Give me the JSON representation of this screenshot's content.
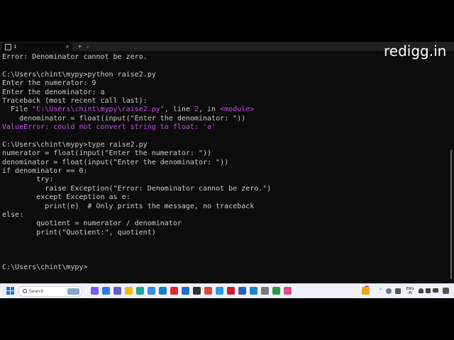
{
  "tabbar": {
    "tab_title": "1",
    "close_glyph": "×",
    "new_tab_glyph": "+",
    "dropdown_glyph": "⌄"
  },
  "watermark": "redigg.in",
  "terminal": {
    "lines": [
      [
        {
          "t": "Error: Denominator cannot be zero."
        }
      ],
      [
        {
          "t": ""
        }
      ],
      [
        {
          "t": "C:\\Users\\chint\\mypy>python raise2.py"
        }
      ],
      [
        {
          "t": "Enter the numerator: 9"
        }
      ],
      [
        {
          "t": "Enter the denominator: a"
        }
      ],
      [
        {
          "t": "Traceback (most recent call last):"
        }
      ],
      [
        {
          "t": "  File "
        },
        {
          "t": "\"C:\\Users\\chint\\mypy\\raise2.py\"",
          "c": "pink"
        },
        {
          "t": ", line "
        },
        {
          "t": "2",
          "c": "pink"
        },
        {
          "t": ", in "
        },
        {
          "t": "<module>",
          "c": "pink"
        }
      ],
      [
        {
          "t": "    denominator = float(input(\"Enter the denominator: \"))"
        }
      ],
      [
        {
          "t": "ValueError",
          "c": "pink"
        },
        {
          "t": ": could not convert string to float: 'a'",
          "c": "pink"
        }
      ],
      [
        {
          "t": ""
        }
      ],
      [
        {
          "t": "C:\\Users\\chint\\mypy>type raise2.py"
        }
      ],
      [
        {
          "t": "numerator = float(input(\"Enter the numerator: \"))"
        }
      ],
      [
        {
          "t": "denominator = float(input(\"Enter the denominator: \"))"
        }
      ],
      [
        {
          "t": "if denominator == 0:"
        }
      ],
      [
        {
          "t": "        try:"
        }
      ],
      [
        {
          "t": "          raise Exception(\"Error: Denominator cannot be zero.\")"
        }
      ],
      [
        {
          "t": "        except Exception as e:"
        }
      ],
      [
        {
          "t": "          print(e)  # Only prints the message, no traceback"
        }
      ],
      [
        {
          "t": "else:"
        }
      ],
      [
        {
          "t": "        quotient = numerator / denominator"
        }
      ],
      [
        {
          "t": "        print(\"Quotient:\", quotient)"
        }
      ],
      [
        {
          "t": ""
        }
      ],
      [
        {
          "t": ""
        }
      ],
      [
        {
          "t": ""
        }
      ],
      [
        {
          "t": "C:\\Users\\chint\\mypy>"
        }
      ]
    ]
  },
  "taskbar": {
    "search_placeholder": "Search",
    "lang_line1": "ENG",
    "lang_line2": "IN",
    "badge_count": "1",
    "tray_up_glyph": "^",
    "apps": [
      {
        "name": "copilot-icon",
        "color": "#7a5cf0"
      },
      {
        "name": "task-view-icon",
        "color": "#2d7be5"
      },
      {
        "name": "teams-icon",
        "color": "#5b5fc7"
      },
      {
        "name": "file-explorer-icon",
        "color": "#f2b91b"
      },
      {
        "name": "edge-icon",
        "color": "#1aa89a"
      },
      {
        "name": "photos-icon",
        "color": "#3a8ee6"
      },
      {
        "name": "store-icon",
        "color": "#1780c8"
      },
      {
        "name": "youtube-icon",
        "color": "#e3262c"
      },
      {
        "name": "mail-icon",
        "color": "#1c6fd1"
      },
      {
        "name": "terminal-icon",
        "color": "#2f2f2f"
      },
      {
        "name": "chrome-icon",
        "color": "#d94a3c"
      },
      {
        "name": "media-icon",
        "color": "#2a9be3"
      },
      {
        "name": "acrobat-icon",
        "color": "#c8202b"
      },
      {
        "name": "pdf-icon",
        "color": "#2b5fb5"
      },
      {
        "name": "vscode-icon",
        "color": "#1f86d6"
      },
      {
        "name": "files-icon",
        "color": "#7a7a7a"
      },
      {
        "name": "notes-icon",
        "color": "#2c9b4a"
      },
      {
        "name": "paint-icon",
        "color": "#e44b8e"
      }
    ]
  }
}
